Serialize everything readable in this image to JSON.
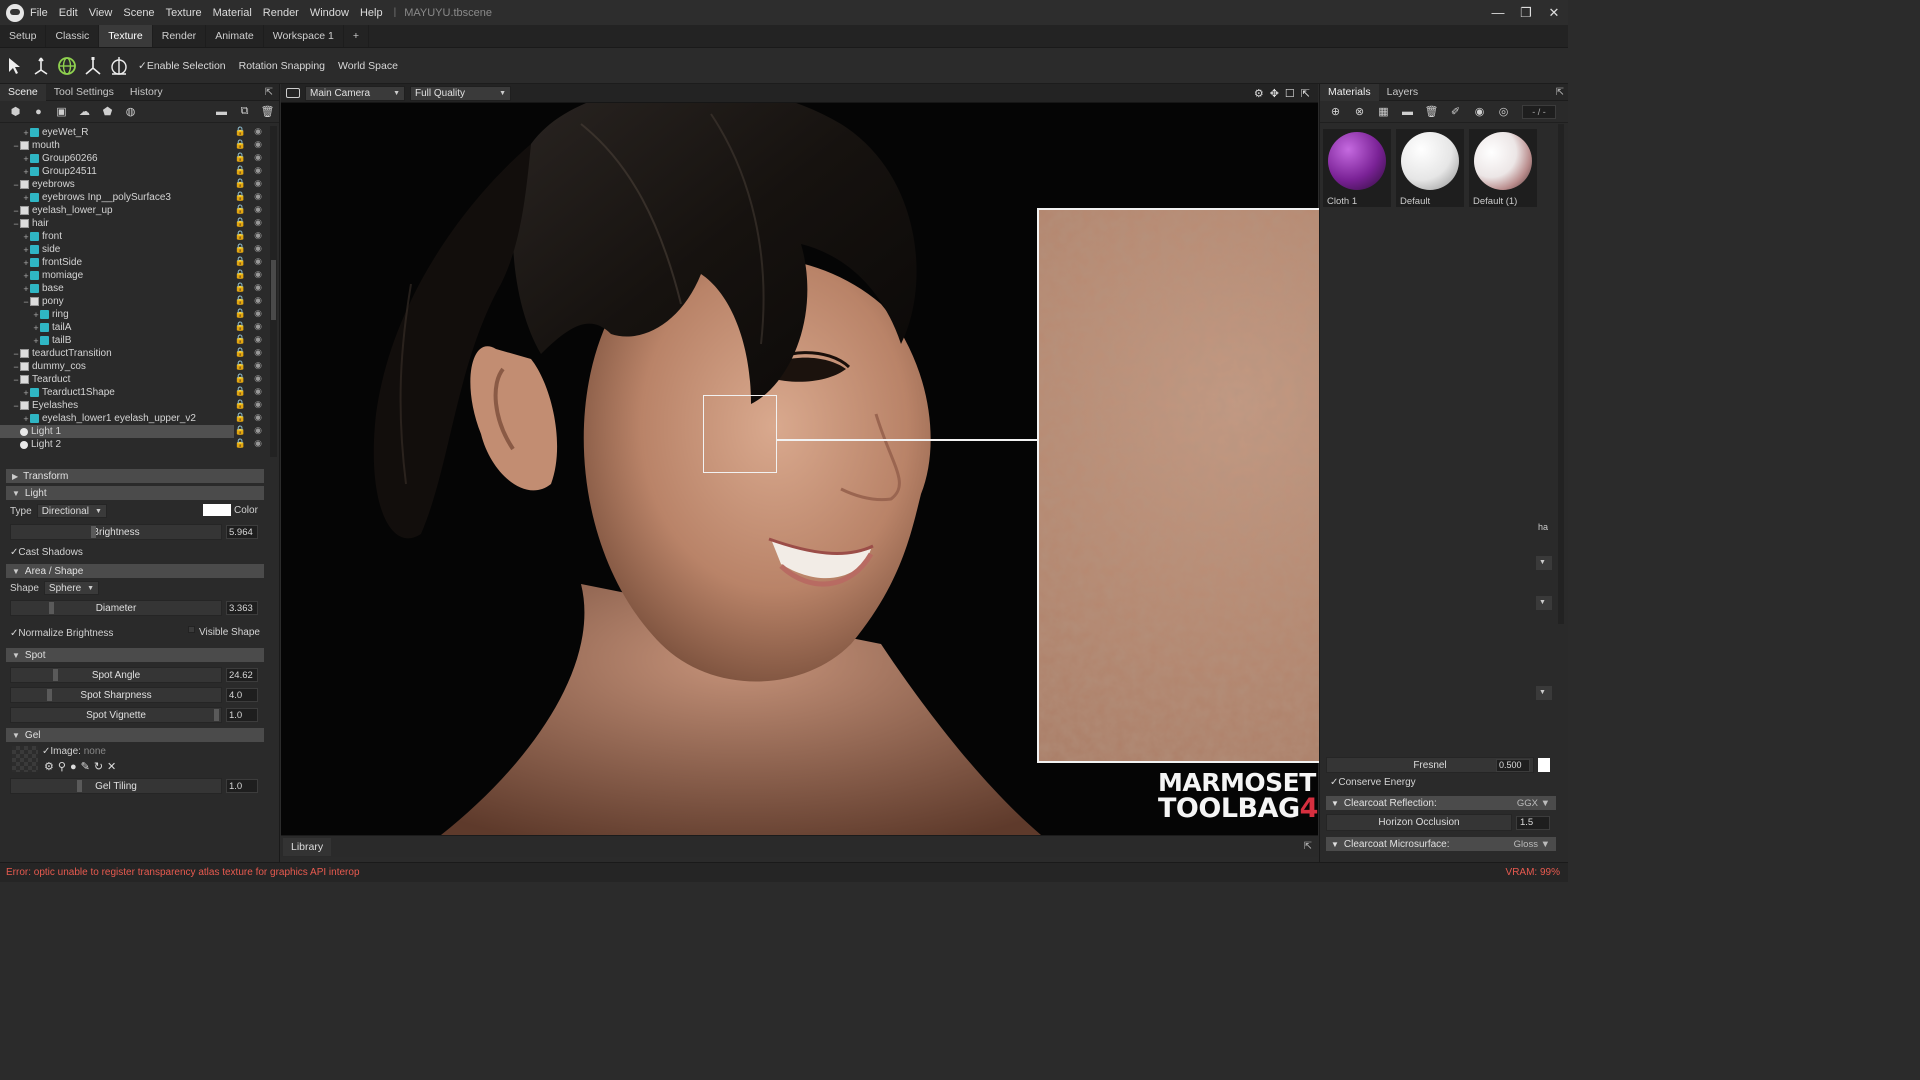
{
  "app": {
    "menu": [
      "File",
      "Edit",
      "View",
      "Scene",
      "Texture",
      "Material",
      "Render",
      "Window",
      "Help"
    ],
    "filename": "MAYUYU.tbscene",
    "window_buttons": [
      "—",
      "❐",
      "✕"
    ]
  },
  "workspace_tabs": [
    {
      "label": "Setup",
      "active": false
    },
    {
      "label": "Classic",
      "active": false
    },
    {
      "label": "Texture",
      "active": true
    },
    {
      "label": "Render",
      "active": false
    },
    {
      "label": "Animate",
      "active": false
    },
    {
      "label": "Workspace 1",
      "active": false
    },
    {
      "label": "+",
      "active": false
    }
  ],
  "toolbar": {
    "enable_selection": "Enable Selection",
    "rotation_snapping": "Rotation Snapping",
    "world_space": "World Space"
  },
  "left_tabs": [
    "Scene",
    "Tool Settings",
    "History"
  ],
  "scene_tree": [
    {
      "label": "eyeWet_R",
      "depth": 1,
      "type": "mesh"
    },
    {
      "label": "mouth",
      "depth": 0,
      "type": "group"
    },
    {
      "label": "Group60266",
      "depth": 1,
      "type": "mesh"
    },
    {
      "label": "Group24511",
      "depth": 1,
      "type": "mesh"
    },
    {
      "label": "eyebrows",
      "depth": 0,
      "type": "group"
    },
    {
      "label": "eyebrows Inp__polySurface3",
      "depth": 1,
      "type": "mesh"
    },
    {
      "label": "eyelash_lower_up",
      "depth": 0,
      "type": "group"
    },
    {
      "label": "hair",
      "depth": 0,
      "type": "group"
    },
    {
      "label": "front",
      "depth": 1,
      "type": "mesh"
    },
    {
      "label": "side",
      "depth": 1,
      "type": "mesh"
    },
    {
      "label": "frontSide",
      "depth": 1,
      "type": "mesh"
    },
    {
      "label": "momiage",
      "depth": 1,
      "type": "mesh"
    },
    {
      "label": "base",
      "depth": 1,
      "type": "mesh"
    },
    {
      "label": "pony",
      "depth": 1,
      "type": "group"
    },
    {
      "label": "ring",
      "depth": 2,
      "type": "mesh"
    },
    {
      "label": "tailA",
      "depth": 2,
      "type": "mesh"
    },
    {
      "label": "tailB",
      "depth": 2,
      "type": "mesh"
    },
    {
      "label": "tearductTransition",
      "depth": 0,
      "type": "group"
    },
    {
      "label": "dummy_cos",
      "depth": 0,
      "type": "group"
    },
    {
      "label": "Tearduct",
      "depth": 0,
      "type": "group"
    },
    {
      "label": "Tearduct1Shape",
      "depth": 1,
      "type": "mesh"
    },
    {
      "label": "Eyelashes",
      "depth": 0,
      "type": "group"
    },
    {
      "label": "eyelash_lower1 eyelash_upper_v2",
      "depth": 1,
      "type": "mesh"
    },
    {
      "label": "Light 1",
      "depth": 0,
      "type": "light",
      "selected": true
    },
    {
      "label": "Light 2",
      "depth": 0,
      "type": "light"
    }
  ],
  "properties": {
    "transform_hdr": "Transform",
    "light_hdr": "Light",
    "type_label": "Type",
    "type_value": "Directional",
    "color_label": "Color",
    "brightness_label": "Brightness",
    "brightness_value": "5.964",
    "cast_shadows": "Cast Shadows",
    "area_hdr": "Area / Shape",
    "shape_label": "Shape",
    "shape_value": "Sphere",
    "diameter_label": "Diameter",
    "diameter_value": "3.363",
    "normalize_brightness": "Normalize Brightness",
    "visible_shape": "Visible Shape",
    "spot_hdr": "Spot",
    "spot_angle_label": "Spot Angle",
    "spot_angle_value": "24.62",
    "spot_sharpness_label": "Spot Sharpness",
    "spot_sharpness_value": "4.0",
    "spot_vignette_label": "Spot Vignette",
    "spot_vignette_value": "1.0",
    "gel_hdr": "Gel",
    "image_label": "Image:",
    "image_value": "none",
    "gel_tiling_label": "Gel Tiling",
    "gel_tiling_value": "1.0"
  },
  "viewport": {
    "camera": "Main Camera",
    "quality": "Full Quality",
    "library_tab": "Library",
    "logo_line1": "MARMOSET",
    "logo_line2": "TOOLBAG",
    "logo_four": "4"
  },
  "right_panel": {
    "tabs": [
      "Materials",
      "Layers"
    ],
    "counter": "- / -",
    "materials": [
      {
        "label": "Cloth 1",
        "color": "#8a2fa8"
      },
      {
        "label": "Default",
        "color": "#f2f2f2"
      },
      {
        "label": "Default (1)",
        "color": "#e8e0e0"
      }
    ],
    "partial_tab": "ha",
    "fresnel_label": "Fresnel",
    "fresnel_value": "0.500",
    "conserve_energy": "Conserve Energy",
    "clearcoat_reflection": "Clearcoat Reflection:",
    "clearcoat_reflection_mode": "GGX",
    "horizon_occlusion_label": "Horizon Occlusion",
    "horizon_occlusion_value": "1.5",
    "clearcoat_microsurface": "Clearcoat Microsurface:",
    "clearcoat_microsurface_mode": "Gloss"
  },
  "status": {
    "error": "Error: optic unable to register transparency atlas texture for graphics API interop",
    "vram": "VRAM: 99%"
  }
}
